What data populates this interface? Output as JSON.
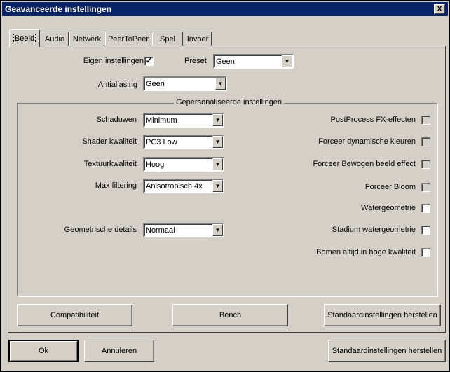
{
  "window": {
    "title": "Geavanceerde instellingen",
    "close_glyph": "X"
  },
  "tabs": [
    {
      "label": "Beeld",
      "active": true
    },
    {
      "label": "Audio"
    },
    {
      "label": "Netwerk"
    },
    {
      "label": "PeerToPeer"
    },
    {
      "label": "Spel"
    },
    {
      "label": "Invoer"
    }
  ],
  "beeld": {
    "own_settings": {
      "label": "Eigen instellingen",
      "checked": true,
      "mark": "✓"
    },
    "preset": {
      "label": "Preset",
      "value": "Geen"
    },
    "antialiasing": {
      "label": "Antialiasing",
      "value": "Geen"
    },
    "custom_group": {
      "title": "Gepersonaliseerde instellingen",
      "dropdowns": [
        {
          "label": "Schaduwen",
          "value": "Minimum"
        },
        {
          "label": "Shader kwaliteit",
          "value": "PC3 Low"
        },
        {
          "label": "Textuurkwaliteit",
          "value": "Hoog"
        },
        {
          "label": "Max filtering",
          "value": "Anisotropisch 4x"
        },
        {
          "label": "Geometrische details",
          "value": "Normaal"
        }
      ],
      "checkboxes": [
        {
          "label": "PostProcess FX-effecten",
          "checked": false
        },
        {
          "label": "Forceer dynamische kleuren",
          "checked": false
        },
        {
          "label": "Forceer Bewogen beeld effect",
          "checked": false
        },
        {
          "label": "Forceer Bloom",
          "checked": false
        },
        {
          "label": "Watergeometrie",
          "checked": false
        },
        {
          "label": "Stadium watergeometrie",
          "checked": false
        },
        {
          "label": "Bomen altijd in hoge kwaliteit",
          "checked": false
        }
      ]
    },
    "buttons": {
      "compat": "Compatibiliteit",
      "bench": "Bench",
      "reset_tab": "Standaardinstellingen herstellen"
    }
  },
  "footer": {
    "ok": "Ok",
    "cancel": "Annuleren",
    "reset_all": "Standaardinstellingen herstellen"
  },
  "icons": {
    "dropdown_arrow": "▼"
  },
  "colors": {
    "titlebar": "#0a246a",
    "face": "#d4d0c8"
  }
}
